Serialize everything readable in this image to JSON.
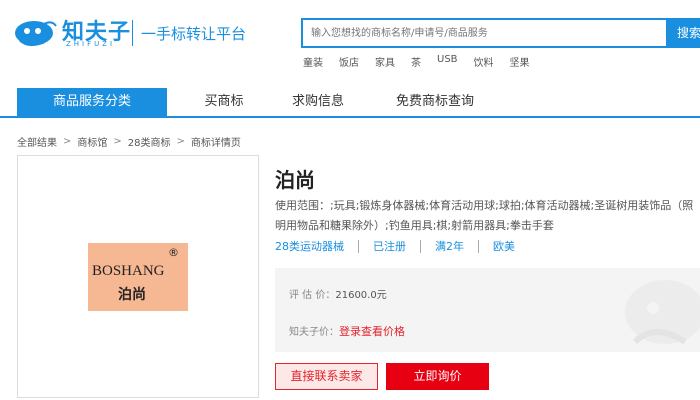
{
  "brand": {
    "name": "知夫子",
    "latin": "ZHIFUZI",
    "slogan": "一手标转让平台"
  },
  "search": {
    "placeholder": "输入您想找的商标名称/申请号/商品服务",
    "button_label": "搜索"
  },
  "hot_words": [
    "童装",
    "饭店",
    "家具",
    "茶",
    "USB",
    "饮料",
    "坚果"
  ],
  "nav": {
    "items": [
      {
        "label": "商品服务分类",
        "active": true
      },
      {
        "label": "买商标"
      },
      {
        "label": "求购信息"
      },
      {
        "label": "免费商标查询"
      }
    ]
  },
  "breadcrumb": [
    "全部结果",
    "商标馆",
    "28类商标",
    "商标详情页"
  ],
  "trademark": {
    "image_latin": "BOSHANG",
    "image_reg_mark": "®",
    "image_cn": "泊尚",
    "card_color": "#f6b793"
  },
  "product": {
    "title": "泊尚",
    "usage": "使用范围：;玩具;锻炼身体器械;体育活动用球;球拍;体育活动器械;圣诞树用装饰品（照明用物品和糖果除外）;钓鱼用具;棋;射箭用器具;拳击手套",
    "tags": [
      "28类运动器械",
      "已注册",
      "满2年",
      "欧美"
    ]
  },
  "price": {
    "estimate_label": "评 估 价：",
    "estimate_value": "21600.0元",
    "zfz_label": "知夫子价：",
    "zfz_link": "登录查看价格"
  },
  "actions": {
    "contact": "直接联系卖家",
    "inquiry": "立即询价"
  },
  "colors": {
    "primary": "#1a8fe0",
    "accent_red": "#e60012"
  }
}
